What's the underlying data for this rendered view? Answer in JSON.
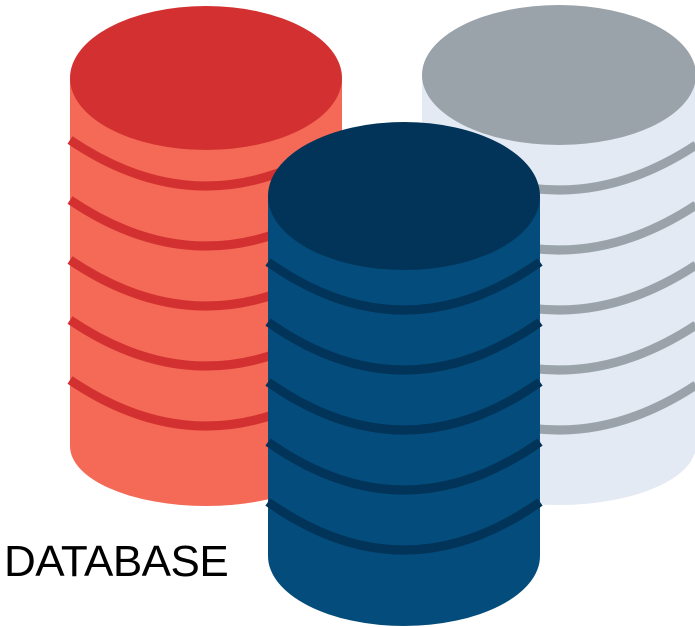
{
  "caption": "DATABASE",
  "colors": {
    "red_top": "#d33131",
    "red_body": "#f46a56",
    "red_stripe": "#d33131",
    "gray_top": "#9aa2aa",
    "gray_body": "#e3eaf3",
    "gray_stripe": "#9aa2aa",
    "blue_top": "#023459",
    "blue_body": "#044c7b",
    "blue_stripe": "#023459"
  },
  "icons": [
    "database-cylinder-red",
    "database-cylinder-gray",
    "database-cylinder-blue"
  ]
}
